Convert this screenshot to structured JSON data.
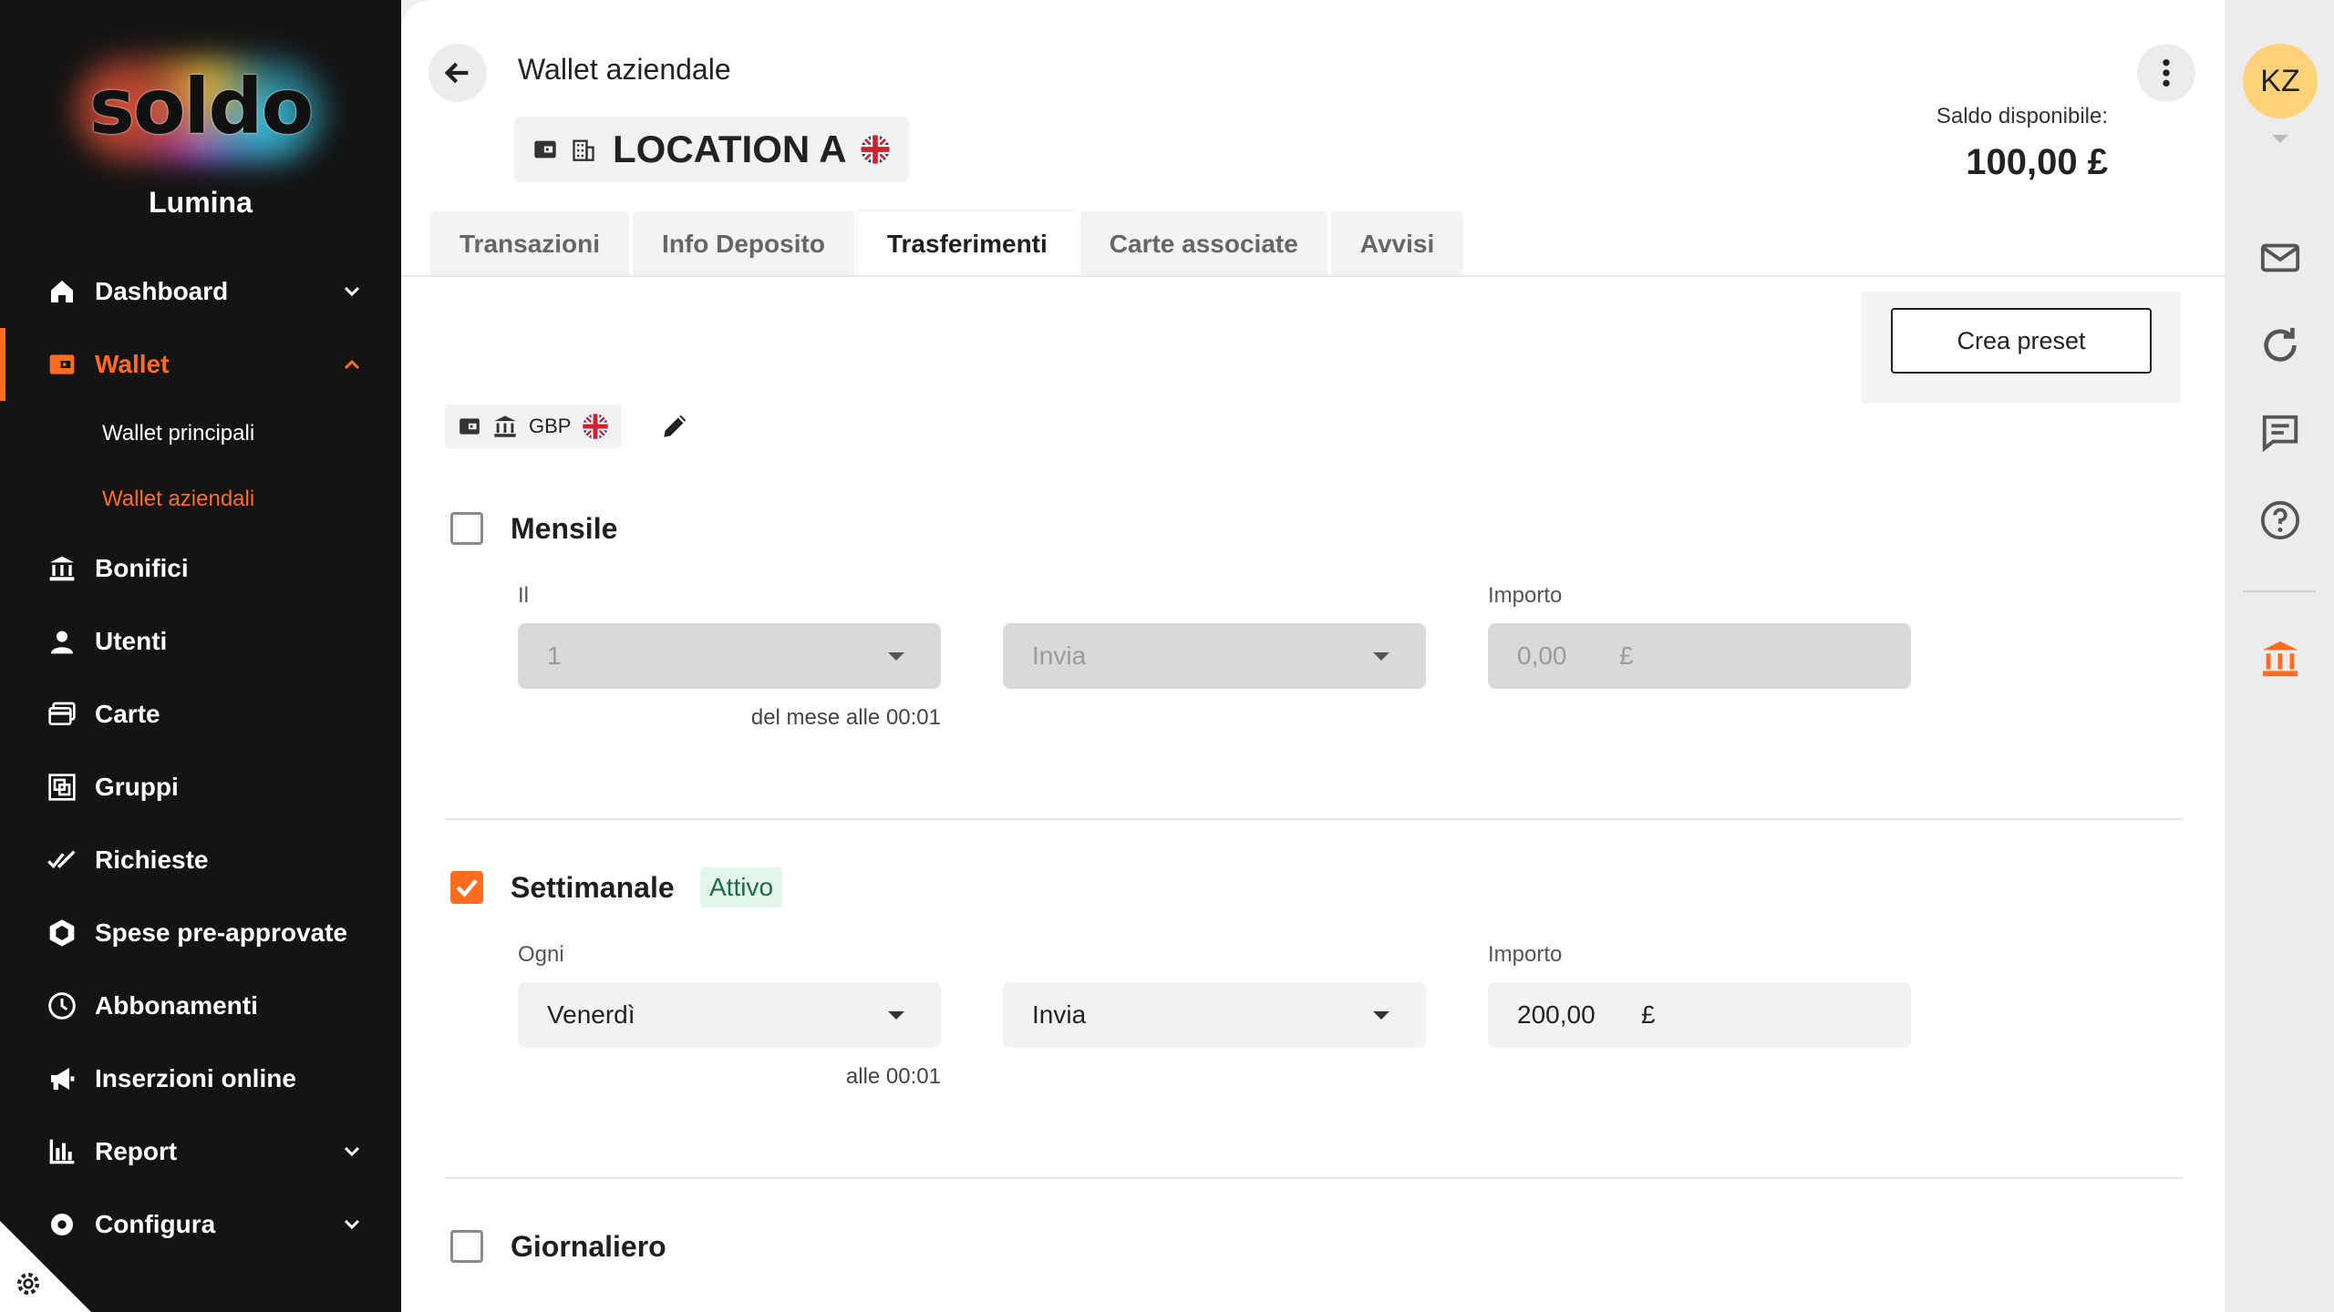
{
  "brand": {
    "logo_text": "soldo",
    "org_name": "Lumina"
  },
  "sidebar": {
    "items": [
      {
        "label": "Dashboard",
        "icon": "home-icon",
        "expandable": true
      },
      {
        "label": "Wallet",
        "icon": "wallet-icon",
        "expandable": true,
        "active": true
      },
      {
        "label": "Bonifici",
        "icon": "bank-transfer-icon"
      },
      {
        "label": "Utenti",
        "icon": "user-icon"
      },
      {
        "label": "Carte",
        "icon": "cards-icon"
      },
      {
        "label": "Gruppi",
        "icon": "groups-icon"
      },
      {
        "label": "Richieste",
        "icon": "double-check-icon"
      },
      {
        "label": "Spese pre-approvate",
        "icon": "hexagon-icon"
      },
      {
        "label": "Abbonamenti",
        "icon": "clock-icon"
      },
      {
        "label": "Inserzioni online",
        "icon": "megaphone-icon"
      },
      {
        "label": "Report",
        "icon": "bar-chart-icon",
        "expandable": true
      },
      {
        "label": "Configura",
        "icon": "settings-icon",
        "expandable": true
      }
    ],
    "wallet_sub": [
      "Wallet principali",
      "Wallet aziendali"
    ]
  },
  "header": {
    "title": "Wallet aziendale",
    "wallet_name": "LOCATION A",
    "balance_label": "Saldo disponibile:",
    "balance_value": "100,00 £"
  },
  "tabs": [
    "Transazioni",
    "Info Deposito",
    "Trasferimenti",
    "Carte associate",
    "Avvisi"
  ],
  "active_tab": "Trasferimenti",
  "preset_button": "Crea preset",
  "currency": "GBP",
  "sections": {
    "monthly": {
      "title": "Mensile",
      "checked": false,
      "day_label": "Il",
      "day_value": "1",
      "action_value": "Invia",
      "amount_label": "Importo",
      "amount_value": "0,00",
      "currency_symbol": "£",
      "hint": "del mese alle 00:01"
    },
    "weekly": {
      "title": "Settimanale",
      "badge": "Attivo",
      "checked": true,
      "day_label": "Ogni",
      "day_value": "Venerdì",
      "action_value": "Invia",
      "amount_label": "Importo",
      "amount_value": "200,00",
      "currency_symbol": "£",
      "hint": "alle 00:01"
    },
    "daily": {
      "title": "Giornaliero",
      "checked": false
    }
  },
  "user": {
    "initials": "KZ"
  },
  "colors": {
    "accent": "#ff6b1f",
    "sidebar_bg": "#141414",
    "active_badge_bg": "#e3f6ec"
  }
}
